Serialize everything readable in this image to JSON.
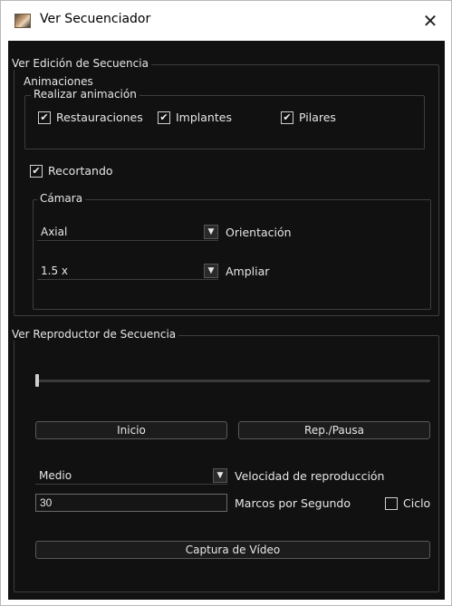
{
  "window": {
    "title": "Ver Secuenciador",
    "close_glyph": "✕"
  },
  "edit": {
    "title": "Ver Edición de Secuencia",
    "animations": {
      "title": "Animaciones",
      "realizar": {
        "title": "Realizar animación",
        "items": [
          {
            "label": "Restauraciones",
            "checked": true
          },
          {
            "label": "Implantes",
            "checked": true
          },
          {
            "label": "Pilares",
            "checked": true
          }
        ]
      },
      "recortando": {
        "label": "Recortando",
        "checked": true
      }
    },
    "camera": {
      "title": "Cámara",
      "orientation": {
        "value": "Axial",
        "label": "Orientación"
      },
      "zoom": {
        "value": "1.5 x",
        "label": "Ampliar"
      }
    }
  },
  "player": {
    "title": "Ver Reproductor de Secuencia",
    "slider": {
      "position": 0
    },
    "start_label": "Inicio",
    "play_pause_label": "Rep./Pausa",
    "speed": {
      "value": "Medio",
      "label": "Velocidad de reproducción"
    },
    "fps": {
      "value": "30",
      "label": "Marcos por Segundo"
    },
    "loop": {
      "label": "Ciclo",
      "checked": false
    },
    "capture_label": "Captura de Vídeo"
  },
  "icons": {
    "check": "✔",
    "dropdown_arrow": "▼"
  }
}
